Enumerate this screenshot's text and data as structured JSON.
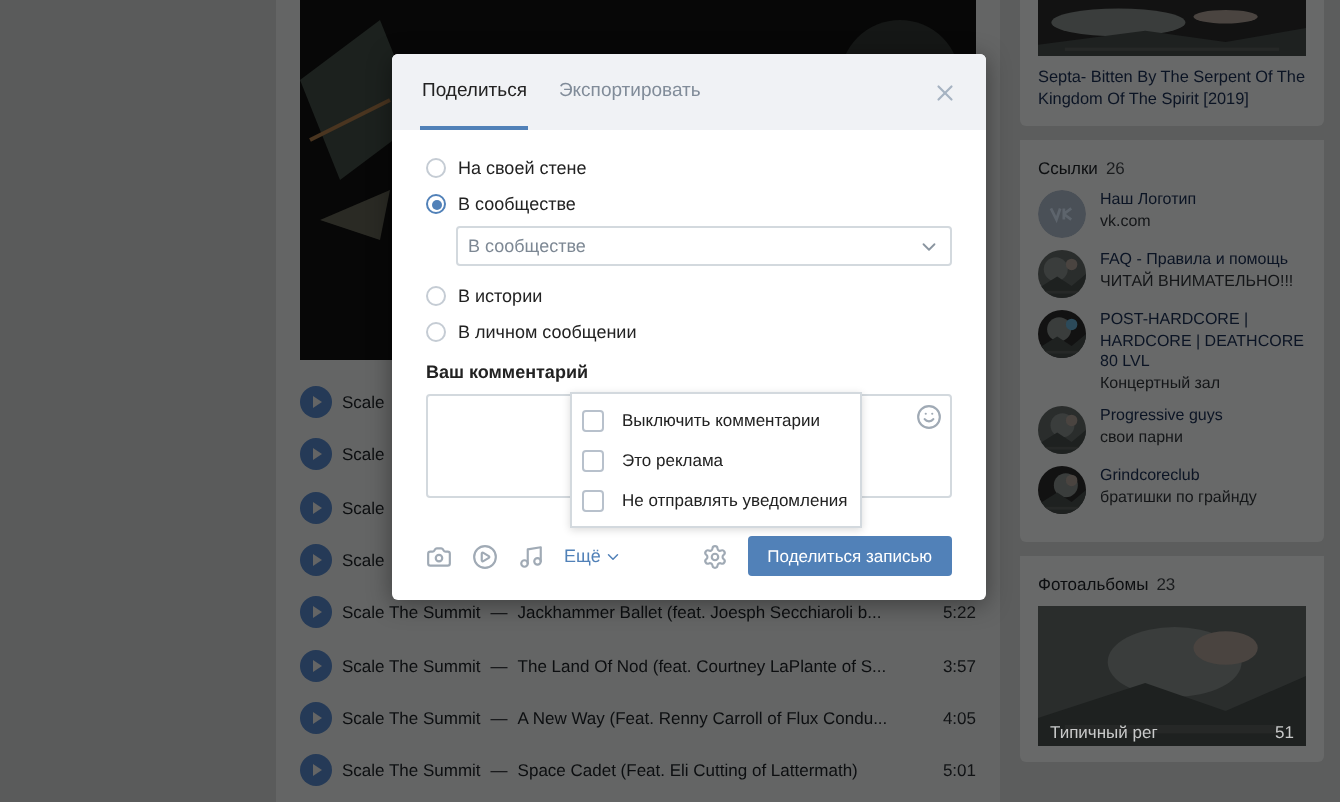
{
  "album_caption": "Septa- Bitten By The Serpent Of The Kingdom Of The Spirit [2019]",
  "tracks": [
    {
      "artist": "Scale"
    },
    {
      "artist": "Scale"
    },
    {
      "artist": "Scale"
    },
    {
      "artist": "Scale"
    },
    {
      "artist": "Scale The Summit",
      "dash": "—",
      "title": "Jackhammer Ballet (feat. Joesph Secchiaroli b...",
      "duration": "5:22"
    },
    {
      "artist": "Scale The Summit",
      "dash": "—",
      "title": "The Land Of Nod (feat. Courtney LaPlante of S...",
      "duration": "3:57"
    },
    {
      "artist": "Scale The Summit",
      "dash": "—",
      "title": "A New Way (Feat. Renny Carroll of Flux Condu...",
      "duration": "4:05"
    },
    {
      "artist": "Scale The Summit",
      "dash": "—",
      "title": "Space Cadet (Feat. Eli Cutting of Lattermath)",
      "duration": "5:01"
    }
  ],
  "links": {
    "title": "Ссылки",
    "count": "26",
    "items": [
      {
        "kind": "logo",
        "name": "Наш Логотип",
        "subtitle": "vk.com"
      },
      {
        "kind": "picture",
        "name": "FAQ - Правила и помощь",
        "subtitle": "ЧИТАЙ ВНИМАТЕЛЬНО!!!"
      },
      {
        "kind": "picture",
        "name": "POST-HARDCORE | HARDCORE | DEATHCORE 80 LVL",
        "subtitle": "Концертный зал"
      },
      {
        "kind": "picture",
        "name": "Progressive guys",
        "subtitle": "свои парни"
      },
      {
        "kind": "picture",
        "name": "Grindcoreclub",
        "subtitle": "братишки по грайнду"
      }
    ]
  },
  "albums": {
    "title": "Фотоальбомы",
    "count": "23",
    "caption": "Типичный рег",
    "photo_count": "51"
  },
  "dialog": {
    "tabs": [
      {
        "label": "Поделиться",
        "selected": true
      },
      {
        "label": "Экспортировать",
        "selected": false
      }
    ],
    "targets": [
      {
        "label": "На своей стене",
        "selected": false
      },
      {
        "label": "В сообществе",
        "selected": true
      },
      {
        "label": "В истории",
        "selected": false
      },
      {
        "label": "В личном сообщении",
        "selected": false
      }
    ],
    "community_select": {
      "placeholder": "В сообществе"
    },
    "comment_label": "Ваш комментарий",
    "options": [
      {
        "label": "Выключить комментарии",
        "checked": false
      },
      {
        "label": "Это реклама",
        "checked": false
      },
      {
        "label": "Не отправлять уведомления",
        "checked": false
      }
    ],
    "more": "Ещё",
    "submit": "Поделиться записью"
  }
}
